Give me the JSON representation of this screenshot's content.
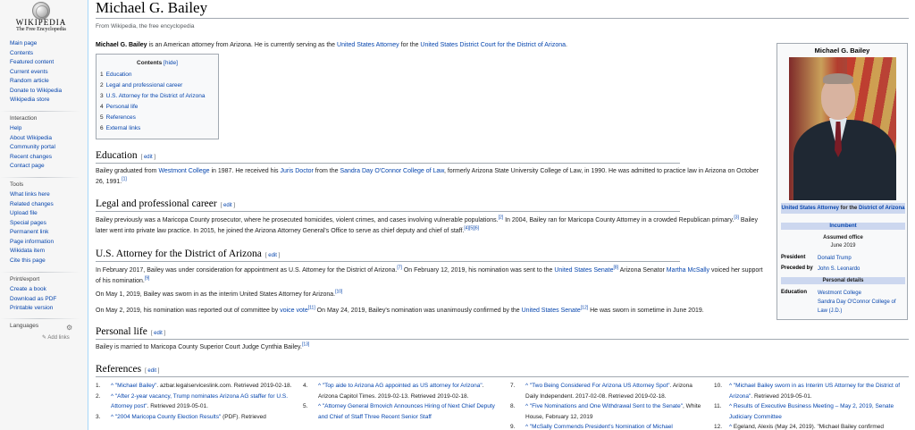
{
  "logo": {
    "wordmark": "WIKIPEDIA",
    "tagline": "The Free Encyclopedia"
  },
  "sidebar": {
    "main": [
      "Main page",
      "Contents",
      "Featured content",
      "Current events",
      "Random article",
      "Donate to Wikipedia",
      "Wikipedia store"
    ],
    "interaction_title": "Interaction",
    "interaction": [
      "Help",
      "About Wikipedia",
      "Community portal",
      "Recent changes",
      "Contact page"
    ],
    "tools_title": "Tools",
    "tools": [
      "What links here",
      "Related changes",
      "Upload file",
      "Special pages",
      "Permanent link",
      "Page information",
      "Wikidata item",
      "Cite this page"
    ],
    "print_title": "Print/export",
    "print": [
      "Create a book",
      "Download as PDF",
      "Printable version"
    ],
    "languages_title": "Languages",
    "add_links": "✎ Add links"
  },
  "page": {
    "title": "Michael G. Bailey",
    "tagline": "From Wikipedia, the free encyclopedia",
    "intro": {
      "bold": "Michael G. Bailey",
      "t1": " is an American attorney from Arizona. He is currently serving as the ",
      "l1": "United States Attorney",
      "t2": " for the ",
      "l2": "United States District Court for the District of Arizona",
      "t3": "."
    }
  },
  "toc": {
    "title": "Contents",
    "hide": "[hide]",
    "items": [
      {
        "num": "1",
        "label": "Education"
      },
      {
        "num": "2",
        "label": "Legal and professional career"
      },
      {
        "num": "3",
        "label": "U.S. Attorney for the District of Arizona"
      },
      {
        "num": "4",
        "label": "Personal life"
      },
      {
        "num": "5",
        "label": "References"
      },
      {
        "num": "6",
        "label": "External links"
      }
    ]
  },
  "edit_label": "edit",
  "sections": {
    "education": {
      "heading": "Education",
      "p1": {
        "t1": "Bailey graduated from ",
        "l1": "Westmont College",
        "t2": " in 1987. He received his ",
        "l2": "Juris Doctor",
        "t3": " from the ",
        "l3": "Sandra Day O'Connor College of Law",
        "t4": ", formerly Arizona State University College of Law, in 1990. He was admitted to practice law in Arizona on October 26, 1991.",
        "s1": "[1]"
      }
    },
    "career": {
      "heading": "Legal and professional career",
      "p1": {
        "t1": "Bailey previously was a Maricopa County prosecutor, where he prosecuted homicides, violent crimes, and cases involving vulnerable populations.",
        "s1": "[2]",
        "t2": " In 2004, Bailey ran for Maricopa County Attorney in a crowded Republican primary.",
        "s2": "[3]",
        "t3": " Bailey later went into private law practice. In 2015, he joined the Arizona Attorney General's Office to serve as chief deputy and chief of staff.",
        "s3": "[4][5][6]"
      }
    },
    "usattorney": {
      "heading": "U.S. Attorney for the District of Arizona",
      "p1": {
        "t1": "In February 2017, Bailey was under consideration for appointment as U.S. Attorney for the District of Arizona.",
        "s1": "[7]",
        "t2": " On February 12, 2019, his nomination was sent to the ",
        "l1": "United States Senate",
        "s2": "[8]",
        "t3": " Arizona Senator ",
        "l2": "Martha McSally",
        "t4": " voiced her support of his nomination.",
        "s3": "[9]"
      },
      "p2": {
        "t1": "On May 1, 2019, Bailey was sworn in as the interim United States Attorney for Arizona.",
        "s1": "[10]"
      },
      "p3": {
        "t1": "On May 2, 2019, his nomination was reported out of committee by ",
        "l1": "voice vote",
        "s1": "[11]",
        "t2": " On May 24, 2019, Bailey's nomination was unanimously confirmed by the ",
        "l2": "United States Senate",
        "s2": "[12]",
        "t3": " He was sworn in sometime in June 2019."
      }
    },
    "personal": {
      "heading": "Personal life",
      "p1": {
        "t1": "Bailey is married to Maricopa County Superior Court Judge Cynthia Bailey.",
        "s1": "[13]"
      }
    },
    "references": {
      "heading": "References"
    }
  },
  "infobox": {
    "name": "Michael G. Bailey",
    "office_link": "United States Attorney",
    "office_rest": " for the ",
    "office_link2": "District of Arizona",
    "incumbent": "Incumbent",
    "assumed_label": "Assumed office",
    "assumed_date": "June 2019",
    "president_label": "President",
    "president": "Donald Trump",
    "preceded_label": "Preceded by",
    "preceded": "John S. Leonardo",
    "personal_details": "Personal details",
    "education_label": "Education",
    "education1": "Westmont College",
    "education2": "Sandra Day O'Connor College of Law (J.D.)"
  },
  "references": [
    [
      {
        "n": "1.",
        "c": "^ ",
        "t": "\"Michael Bailey\"",
        "r": ". azbar.legalserviceslink.com. Retrieved 2019-02-18."
      },
      {
        "n": "2.",
        "c": "^ ",
        "t": "\"After 2-year vacancy, Trump nominates Arizona AG staffer for U.S. Attorney post\"",
        "r": ". Retrieved 2019-05-01."
      },
      {
        "n": "3.",
        "c": "^ ",
        "t": "\"2004 Maricopa County Election Results\"",
        "r": " (PDF). Retrieved"
      }
    ],
    [
      {
        "n": "4.",
        "c": "^ ",
        "t": "\"Top aide to Arizona AG appointed as US attorney for Arizona\"",
        "r": ". Arizona Capitol Times. 2019-02-13. Retrieved 2019-02-18."
      },
      {
        "n": "5.",
        "c": "^ ",
        "t": "\"Attorney General Brnovich Announces Hiring of Next Chief Deputy and Chief of Staff Three Recent Senior Staff",
        "r": ""
      }
    ],
    [
      {
        "n": "7.",
        "c": "^ ",
        "t": "\"Two Being Considered For Arizona US Attorney Spot\"",
        "r": ". Arizona Daily Independent. 2017-02-08. Retrieved 2019-02-18."
      },
      {
        "n": "8.",
        "c": "^ ",
        "t": "\"Five Nominations and One Withdrawal Sent to the Senate\"",
        "r": ", White House, February 12, 2019"
      },
      {
        "n": "9.",
        "c": "^ ",
        "t": "\"McSally Commends President's Nomination of Michael",
        "r": ""
      }
    ],
    [
      {
        "n": "10.",
        "c": "^ ",
        "t": "\"Michael Bailey sworn in as Interim US Attorney for the District of Arizona\"",
        "r": ". Retrieved 2019-05-01."
      },
      {
        "n": "11.",
        "c": "^ ",
        "t": "Results of Executive Business Meeting – May 2, 2019, Senate Judiciary Committee",
        "r": ""
      },
      {
        "n": "12.",
        "c": "^ ",
        "t": "",
        "r": "Egeland, Alexis (May 24, 2019). \"Michael Bailey confirmed"
      }
    ]
  ]
}
